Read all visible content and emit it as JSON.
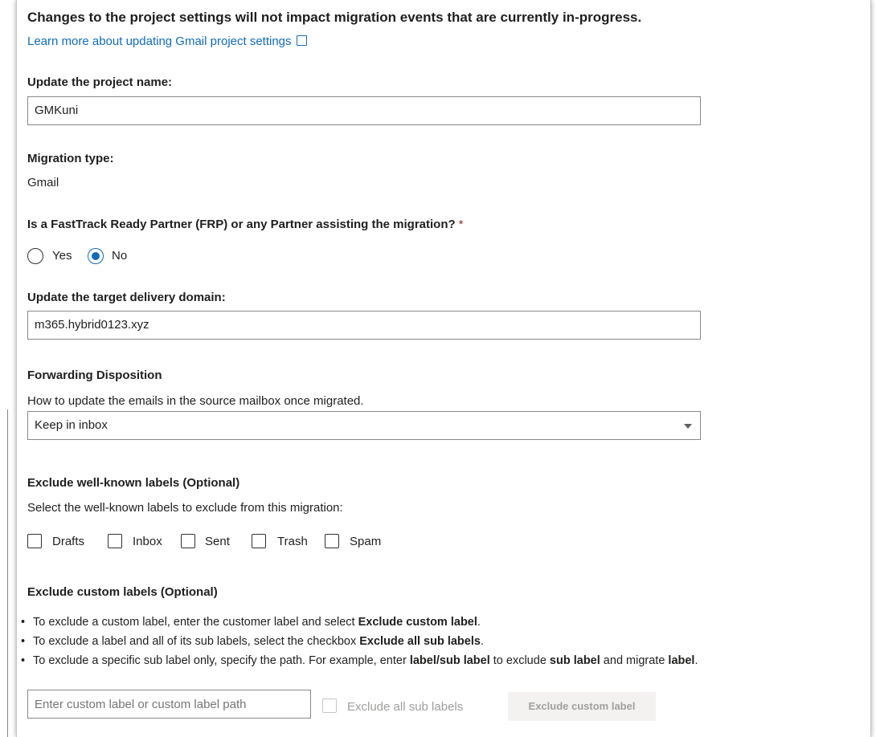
{
  "notice": "Changes to the project settings will not impact migration events that are currently in-progress.",
  "learn_more": "Learn more about updating Gmail project settings",
  "project_name": {
    "label": "Update the project name:",
    "value": "GMKuni"
  },
  "migration_type": {
    "label": "Migration type:",
    "value": "Gmail"
  },
  "partner": {
    "question": "Is a FastTrack Ready Partner (FRP) or any Partner assisting the migration?",
    "required_mark": "*",
    "yes": "Yes",
    "no": "No",
    "selected": "No"
  },
  "delivery_domain": {
    "label": "Update the target delivery domain:",
    "value": "m365.hybrid0123.xyz"
  },
  "forwarding": {
    "label": "Forwarding Disposition",
    "description": "How to update the emails in the source mailbox once migrated.",
    "selected": "Keep in inbox"
  },
  "well_known": {
    "label": "Exclude well-known labels (Optional)",
    "description": "Select the well-known labels to exclude from this migration:",
    "options": [
      "Drafts",
      "Inbox",
      "Sent",
      "Trash",
      "Spam"
    ]
  },
  "custom": {
    "label": "Exclude custom labels (Optional)",
    "b1_pre": "To exclude a custom label, enter the customer label and select ",
    "b1_bold": "Exclude custom label",
    "b1_post": ".",
    "b2_pre": "To exclude a label and all of its sub labels, select the checkbox ",
    "b2_bold": "Exclude all sub labels",
    "b2_post": ".",
    "b3_pre": "To exclude a specific sub label only, specify the path. For example, enter ",
    "b3_bold1": "label/sub label",
    "b3_mid1": " to exclude ",
    "b3_bold2": "sub label",
    "b3_mid2": " and migrate ",
    "b3_bold3": "label",
    "b3_post": ".",
    "placeholder": "Enter custom label or custom label path",
    "sub_checkbox": "Exclude all sub labels",
    "button": "Exclude custom label"
  }
}
